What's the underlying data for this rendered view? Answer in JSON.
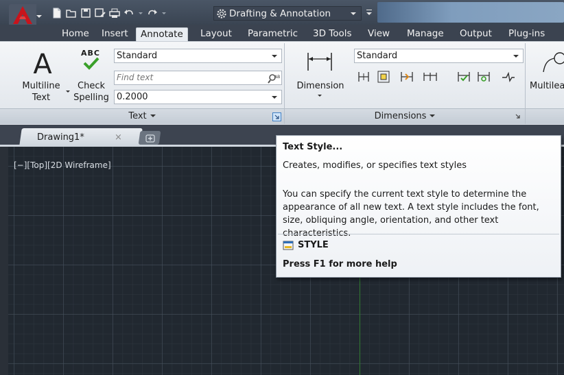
{
  "workspace": {
    "label": "Drafting & Annotation"
  },
  "ribbon_tabs": [
    "Home",
    "Insert",
    "Annotate",
    "Layout",
    "Parametric",
    "3D Tools",
    "View",
    "Manage",
    "Output",
    "Plug-ins"
  ],
  "active_tab": "Annotate",
  "text_panel": {
    "multiline_text": {
      "line1": "Multiline",
      "line2": "Text"
    },
    "check_spelling": {
      "badge": "ABC",
      "line1": "Check",
      "line2": "Spelling"
    },
    "style_value": "Standard",
    "find_placeholder": "Find text",
    "height_value": "0.2000",
    "title": "Text"
  },
  "dimensions_panel": {
    "dimension_label": "Dimension",
    "style_value": "Standard",
    "title": "Dimensions"
  },
  "multileader_panel": {
    "label": "Multilea"
  },
  "document_tab": {
    "label": "Drawing1*",
    "close": "×"
  },
  "viewport": {
    "label": "[−][Top][2D Wireframe]"
  },
  "tooltip": {
    "title": "Text Style...",
    "description": "Creates, modifies, or specifies text styles",
    "body": "You can specify the current text style to determine the appearance of all new text. A text style includes the font, size, obliquing angle, orientation, and other text characteristics.",
    "command": "STYLE",
    "help": "Press F1 for more help"
  },
  "colors": {
    "accent_red": "#c8141c",
    "canvas": "#212830",
    "check_green": "#3aa02a"
  }
}
